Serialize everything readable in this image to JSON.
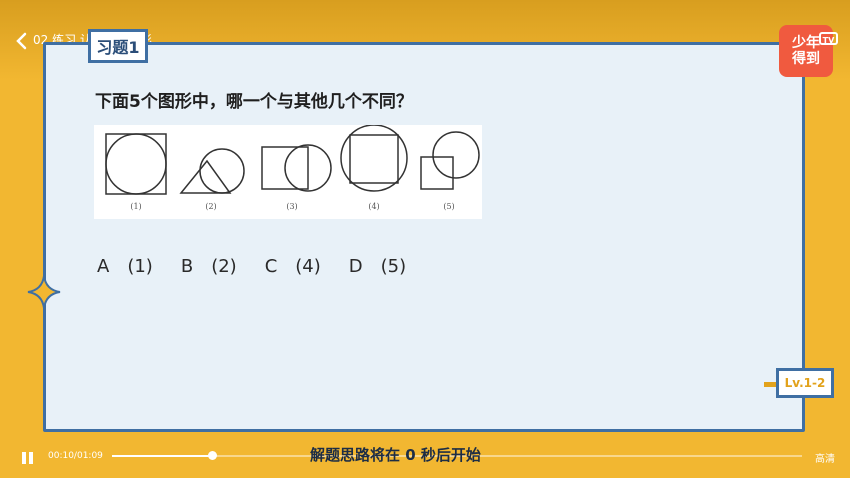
{
  "header": {
    "title": "02 练习 认识平面图形"
  },
  "tag": {
    "label": "习题1"
  },
  "logo": {
    "line1": "少年",
    "line2": "得到",
    "tv": "TV"
  },
  "question": {
    "text": "下面5个图形中，哪一个与其他几个不同？"
  },
  "figure": {
    "labels": [
      "(1)",
      "(2)",
      "(3)",
      "(4)",
      "(5)"
    ]
  },
  "options": [
    {
      "letter": "A",
      "value": "(1)"
    },
    {
      "letter": "B",
      "value": "(2)"
    },
    {
      "letter": "C",
      "value": "(4)"
    },
    {
      "letter": "D",
      "value": "(5)"
    }
  ],
  "level": {
    "label": "Lv.1-2"
  },
  "player": {
    "time": "00:10/01:09",
    "progress": 0.145,
    "quality": "高清",
    "caption": "解题思路将在 0 秒后开始"
  }
}
